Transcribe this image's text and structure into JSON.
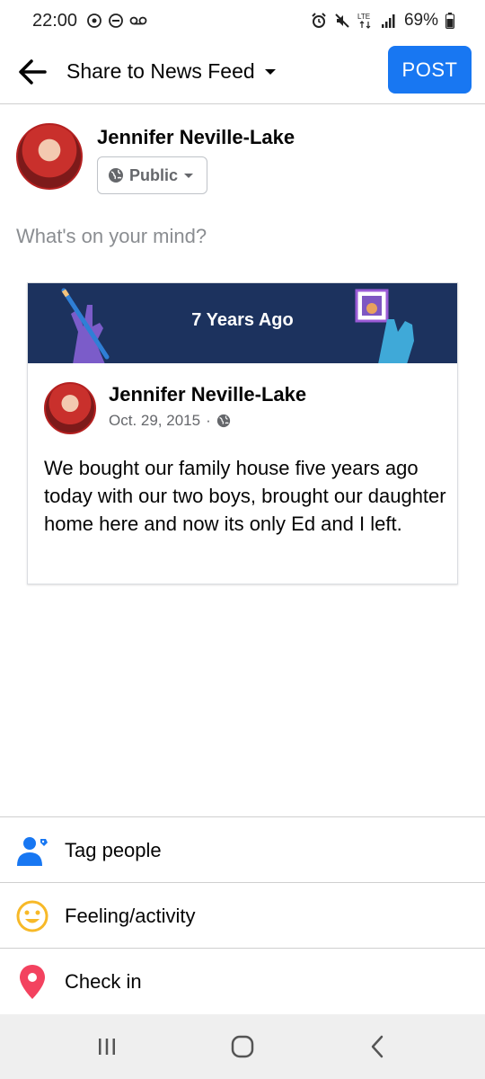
{
  "status_bar": {
    "time": "22:00",
    "battery": "69%",
    "network": "LTE",
    "icons": [
      "whatsapp-icon",
      "do-not-disturb-icon",
      "voicemail-icon",
      "alarm-icon",
      "mute-icon",
      "lte-icon",
      "signal-icon",
      "battery-icon"
    ]
  },
  "header": {
    "title": "Share to News Feed",
    "post_label": "POST",
    "accent": "#1877f2"
  },
  "composer": {
    "user_name": "Jennifer Neville-Lake",
    "audience": "Public",
    "placeholder": "What's on your mind?"
  },
  "memory": {
    "banner_title": "7 Years Ago",
    "banner_color": "#1c325e",
    "author": "Jennifer Neville-Lake",
    "date": "Oct. 29, 2015",
    "separator": "·",
    "text": "We bought our family house five years ago today with our two boys, brought our daughter home here and now its only Ed and I left."
  },
  "options": [
    {
      "label": "Tag people",
      "icon": "tag-people-icon",
      "color": "#1877f2"
    },
    {
      "label": "Feeling/activity",
      "icon": "smiley-icon",
      "color": "#f7b928"
    },
    {
      "label": "Check in",
      "icon": "location-pin-icon",
      "color": "#f3425f"
    }
  ]
}
